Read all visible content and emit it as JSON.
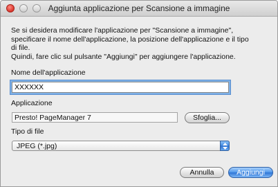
{
  "window": {
    "title": "Aggiunta applicazione per Scansione a immagine"
  },
  "description": {
    "lines": [
      "Se si desidera modificare l'applicazione per \"Scansione a immagine\",",
      "specificare il nome dell'applicazione, la posizione dell'applicazione e il tipo",
      "di file.",
      "Quindi, fare clic sul pulsante \"Aggiungi\" per aggiungere l'applicazione."
    ]
  },
  "name_field": {
    "label": "Nome dell'applicazione",
    "value": "XXXXXX"
  },
  "application_field": {
    "label": "Applicazione",
    "value": "Presto! PageManager 7",
    "browse_label": "Sfoglia..."
  },
  "file_type": {
    "label": "Tipo di file",
    "selected": "JPEG (*.jpg)"
  },
  "buttons": {
    "cancel": "Annulla",
    "add": "Aggiungi"
  },
  "colors": {
    "default_button": "#3b82e0",
    "close_button": "#e0443a"
  }
}
